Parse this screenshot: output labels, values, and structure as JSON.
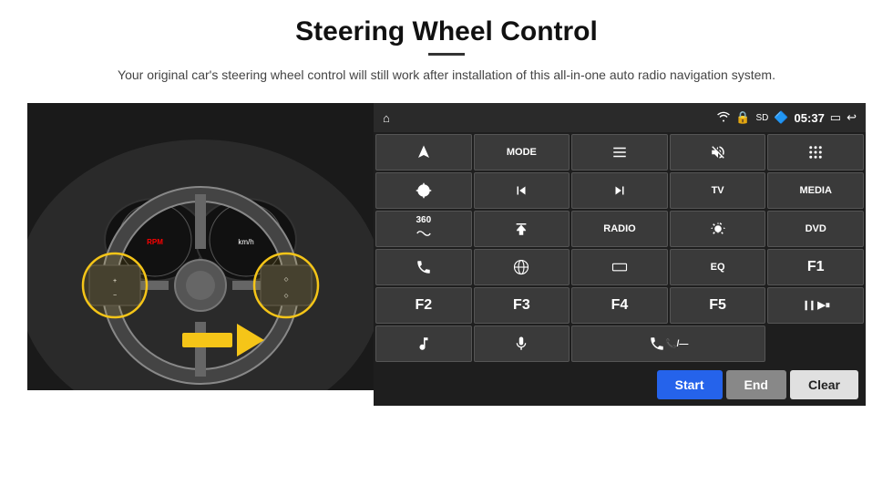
{
  "header": {
    "title": "Steering Wheel Control",
    "subtitle": "Your original car's steering wheel control will still work after installation of this all-in-one auto radio navigation system."
  },
  "status_bar": {
    "time": "05:37"
  },
  "buttons": [
    {
      "id": "nav",
      "type": "icon",
      "icon": "navigate"
    },
    {
      "id": "mode",
      "type": "text",
      "label": "MODE"
    },
    {
      "id": "list",
      "type": "icon",
      "icon": "list"
    },
    {
      "id": "mute",
      "type": "icon",
      "icon": "mute"
    },
    {
      "id": "apps",
      "type": "icon",
      "icon": "apps"
    },
    {
      "id": "settings",
      "type": "icon",
      "icon": "settings"
    },
    {
      "id": "prev",
      "type": "icon",
      "icon": "prev"
    },
    {
      "id": "next",
      "type": "icon",
      "icon": "next"
    },
    {
      "id": "tv",
      "type": "text",
      "label": "TV"
    },
    {
      "id": "media",
      "type": "text",
      "label": "MEDIA"
    },
    {
      "id": "cam360",
      "type": "icon",
      "icon": "360cam"
    },
    {
      "id": "eject",
      "type": "icon",
      "icon": "eject"
    },
    {
      "id": "radio",
      "type": "text",
      "label": "RADIO"
    },
    {
      "id": "brightness",
      "type": "icon",
      "icon": "brightness"
    },
    {
      "id": "dvd",
      "type": "text",
      "label": "DVD"
    },
    {
      "id": "phone",
      "type": "icon",
      "icon": "phone"
    },
    {
      "id": "browser",
      "type": "icon",
      "icon": "browser"
    },
    {
      "id": "widescreen",
      "type": "icon",
      "icon": "widescreen"
    },
    {
      "id": "eq",
      "type": "text",
      "label": "EQ"
    },
    {
      "id": "f1",
      "type": "text",
      "label": "F1"
    },
    {
      "id": "f2",
      "type": "text",
      "label": "F2"
    },
    {
      "id": "f3",
      "type": "text",
      "label": "F3"
    },
    {
      "id": "f4",
      "type": "text",
      "label": "F4"
    },
    {
      "id": "f5",
      "type": "text",
      "label": "F5"
    },
    {
      "id": "playpause",
      "type": "icon",
      "icon": "playpause"
    },
    {
      "id": "music",
      "type": "icon",
      "icon": "music"
    },
    {
      "id": "mic",
      "type": "icon",
      "icon": "mic"
    },
    {
      "id": "hangup",
      "type": "icon",
      "icon": "hangup"
    }
  ],
  "bottom_buttons": {
    "start": "Start",
    "end": "End",
    "clear": "Clear"
  }
}
